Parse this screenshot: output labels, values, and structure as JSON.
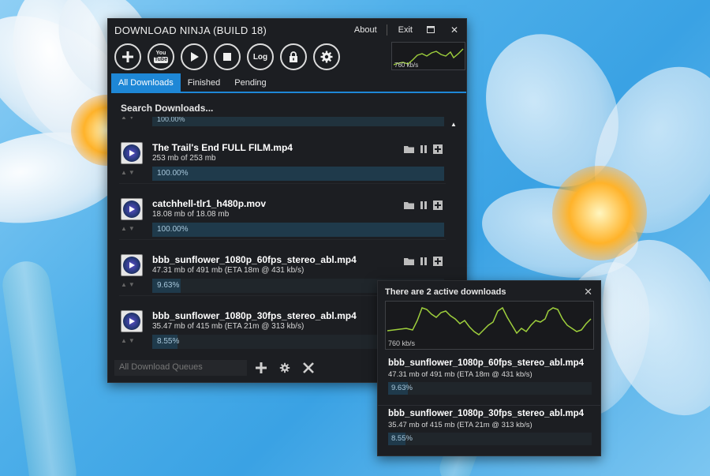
{
  "app": {
    "title": "DOWNLOAD NINJA (BUILD 18)",
    "about": "About",
    "exit": "Exit",
    "maximize_icon": "maximize-icon",
    "close_icon": "close-icon"
  },
  "toolbar": {
    "buttons": [
      "add-icon",
      "youtube-icon",
      "play-icon",
      "stop-icon",
      "log-icon",
      "lock-icon",
      "gear-icon"
    ],
    "youtube_label_top": "You",
    "youtube_label_bottom": "Tube",
    "log_label": "Log"
  },
  "speed_graph": {
    "label": "760 kb/s",
    "color": "#9ecf3c"
  },
  "tabs": [
    {
      "label": "All Downloads",
      "active": true
    },
    {
      "label": "Finished",
      "active": false
    },
    {
      "label": "Pending",
      "active": false
    }
  ],
  "search_label": "Search Downloads...",
  "partial_item": {
    "percent_text": "100.00%"
  },
  "downloads": [
    {
      "name": "The Trail's End FULL FILM.mp4",
      "size": "253 mb of 253 mb",
      "percent": 100,
      "percent_text": "100.00%"
    },
    {
      "name": "catchhell-tlr1_h480p.mov",
      "size": "18.08 mb of 18.08 mb",
      "percent": 100,
      "percent_text": "100.00%"
    },
    {
      "name": "bbb_sunflower_1080p_60fps_stereo_abl.mp4",
      "size": "47.31 mb of 491 mb (ETA 18m @ 431 kb/s)",
      "percent": 9.63,
      "percent_text": "9.63%"
    },
    {
      "name": "bbb_sunflower_1080p_30fps_stereo_abl.mp4",
      "size": "35.47 mb of 415 mb (ETA 21m @ 313 kb/s)",
      "percent": 8.55,
      "percent_text": "8.55%"
    }
  ],
  "bottom_bar": {
    "queue_label": "All Download Queues",
    "add_icon": "add-icon",
    "settings_icon": "gear-icon",
    "remove_icon": "close-icon"
  },
  "popup": {
    "title": "There are 2 active downloads",
    "graph_label": "760 kb/s",
    "items": [
      {
        "name": "bbb_sunflower_1080p_60fps_stereo_abl.mp4",
        "size": "47.31 mb of 491 mb (ETA 18m @ 431 kb/s)",
        "percent": 9.63,
        "percent_text": "9.63%"
      },
      {
        "name": "bbb_sunflower_1080p_30fps_stereo_abl.mp4",
        "size": "35.47 mb of 415 mb (ETA 21m @ 313 kb/s)",
        "percent": 8.55,
        "percent_text": "8.55%"
      }
    ]
  },
  "colors": {
    "accent": "#1e87d6",
    "window_bg": "#1c1e22",
    "graph_line": "#9ecf3c"
  }
}
